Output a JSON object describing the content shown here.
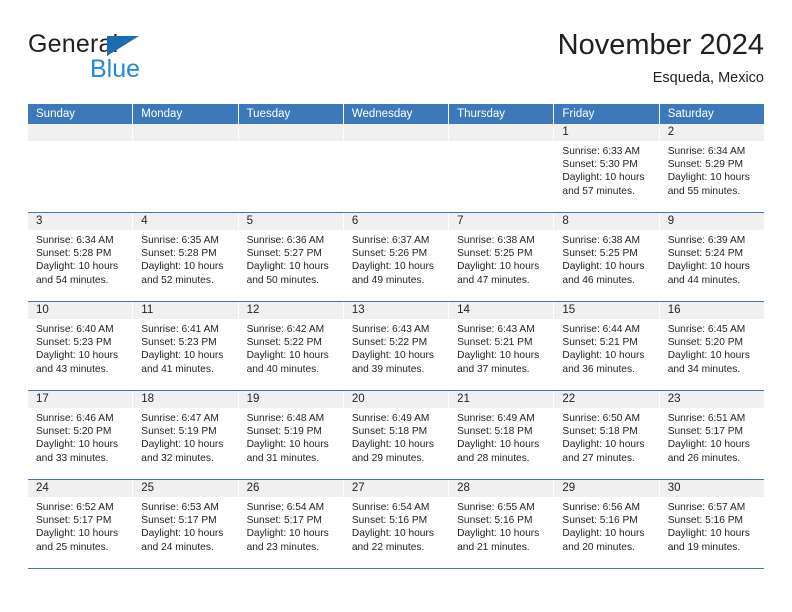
{
  "brand": {
    "name_part1": "General",
    "name_part2": "Blue",
    "triangle_icon": "blue-triangle-icon",
    "accent_color": "#2389d6",
    "header_color": "#3d79ba"
  },
  "header": {
    "title": "November 2024",
    "location": "Esqueda, Mexico"
  },
  "weekdays": [
    "Sunday",
    "Monday",
    "Tuesday",
    "Wednesday",
    "Thursday",
    "Friday",
    "Saturday"
  ],
  "weeks": [
    [
      {
        "day": "",
        "empty": true
      },
      {
        "day": "",
        "empty": true
      },
      {
        "day": "",
        "empty": true
      },
      {
        "day": "",
        "empty": true
      },
      {
        "day": "",
        "empty": true
      },
      {
        "day": "1",
        "sunrise": "Sunrise: 6:33 AM",
        "sunset": "Sunset: 5:30 PM",
        "daylight": "Daylight: 10 hours and 57 minutes."
      },
      {
        "day": "2",
        "sunrise": "Sunrise: 6:34 AM",
        "sunset": "Sunset: 5:29 PM",
        "daylight": "Daylight: 10 hours and 55 minutes."
      }
    ],
    [
      {
        "day": "3",
        "sunrise": "Sunrise: 6:34 AM",
        "sunset": "Sunset: 5:28 PM",
        "daylight": "Daylight: 10 hours and 54 minutes."
      },
      {
        "day": "4",
        "sunrise": "Sunrise: 6:35 AM",
        "sunset": "Sunset: 5:28 PM",
        "daylight": "Daylight: 10 hours and 52 minutes."
      },
      {
        "day": "5",
        "sunrise": "Sunrise: 6:36 AM",
        "sunset": "Sunset: 5:27 PM",
        "daylight": "Daylight: 10 hours and 50 minutes."
      },
      {
        "day": "6",
        "sunrise": "Sunrise: 6:37 AM",
        "sunset": "Sunset: 5:26 PM",
        "daylight": "Daylight: 10 hours and 49 minutes."
      },
      {
        "day": "7",
        "sunrise": "Sunrise: 6:38 AM",
        "sunset": "Sunset: 5:25 PM",
        "daylight": "Daylight: 10 hours and 47 minutes."
      },
      {
        "day": "8",
        "sunrise": "Sunrise: 6:38 AM",
        "sunset": "Sunset: 5:25 PM",
        "daylight": "Daylight: 10 hours and 46 minutes."
      },
      {
        "day": "9",
        "sunrise": "Sunrise: 6:39 AM",
        "sunset": "Sunset: 5:24 PM",
        "daylight": "Daylight: 10 hours and 44 minutes."
      }
    ],
    [
      {
        "day": "10",
        "sunrise": "Sunrise: 6:40 AM",
        "sunset": "Sunset: 5:23 PM",
        "daylight": "Daylight: 10 hours and 43 minutes."
      },
      {
        "day": "11",
        "sunrise": "Sunrise: 6:41 AM",
        "sunset": "Sunset: 5:23 PM",
        "daylight": "Daylight: 10 hours and 41 minutes."
      },
      {
        "day": "12",
        "sunrise": "Sunrise: 6:42 AM",
        "sunset": "Sunset: 5:22 PM",
        "daylight": "Daylight: 10 hours and 40 minutes."
      },
      {
        "day": "13",
        "sunrise": "Sunrise: 6:43 AM",
        "sunset": "Sunset: 5:22 PM",
        "daylight": "Daylight: 10 hours and 39 minutes."
      },
      {
        "day": "14",
        "sunrise": "Sunrise: 6:43 AM",
        "sunset": "Sunset: 5:21 PM",
        "daylight": "Daylight: 10 hours and 37 minutes."
      },
      {
        "day": "15",
        "sunrise": "Sunrise: 6:44 AM",
        "sunset": "Sunset: 5:21 PM",
        "daylight": "Daylight: 10 hours and 36 minutes."
      },
      {
        "day": "16",
        "sunrise": "Sunrise: 6:45 AM",
        "sunset": "Sunset: 5:20 PM",
        "daylight": "Daylight: 10 hours and 34 minutes."
      }
    ],
    [
      {
        "day": "17",
        "sunrise": "Sunrise: 6:46 AM",
        "sunset": "Sunset: 5:20 PM",
        "daylight": "Daylight: 10 hours and 33 minutes."
      },
      {
        "day": "18",
        "sunrise": "Sunrise: 6:47 AM",
        "sunset": "Sunset: 5:19 PM",
        "daylight": "Daylight: 10 hours and 32 minutes."
      },
      {
        "day": "19",
        "sunrise": "Sunrise: 6:48 AM",
        "sunset": "Sunset: 5:19 PM",
        "daylight": "Daylight: 10 hours and 31 minutes."
      },
      {
        "day": "20",
        "sunrise": "Sunrise: 6:49 AM",
        "sunset": "Sunset: 5:18 PM",
        "daylight": "Daylight: 10 hours and 29 minutes."
      },
      {
        "day": "21",
        "sunrise": "Sunrise: 6:49 AM",
        "sunset": "Sunset: 5:18 PM",
        "daylight": "Daylight: 10 hours and 28 minutes."
      },
      {
        "day": "22",
        "sunrise": "Sunrise: 6:50 AM",
        "sunset": "Sunset: 5:18 PM",
        "daylight": "Daylight: 10 hours and 27 minutes."
      },
      {
        "day": "23",
        "sunrise": "Sunrise: 6:51 AM",
        "sunset": "Sunset: 5:17 PM",
        "daylight": "Daylight: 10 hours and 26 minutes."
      }
    ],
    [
      {
        "day": "24",
        "sunrise": "Sunrise: 6:52 AM",
        "sunset": "Sunset: 5:17 PM",
        "daylight": "Daylight: 10 hours and 25 minutes."
      },
      {
        "day": "25",
        "sunrise": "Sunrise: 6:53 AM",
        "sunset": "Sunset: 5:17 PM",
        "daylight": "Daylight: 10 hours and 24 minutes."
      },
      {
        "day": "26",
        "sunrise": "Sunrise: 6:54 AM",
        "sunset": "Sunset: 5:17 PM",
        "daylight": "Daylight: 10 hours and 23 minutes."
      },
      {
        "day": "27",
        "sunrise": "Sunrise: 6:54 AM",
        "sunset": "Sunset: 5:16 PM",
        "daylight": "Daylight: 10 hours and 22 minutes."
      },
      {
        "day": "28",
        "sunrise": "Sunrise: 6:55 AM",
        "sunset": "Sunset: 5:16 PM",
        "daylight": "Daylight: 10 hours and 21 minutes."
      },
      {
        "day": "29",
        "sunrise": "Sunrise: 6:56 AM",
        "sunset": "Sunset: 5:16 PM",
        "daylight": "Daylight: 10 hours and 20 minutes."
      },
      {
        "day": "30",
        "sunrise": "Sunrise: 6:57 AM",
        "sunset": "Sunset: 5:16 PM",
        "daylight": "Daylight: 10 hours and 19 minutes."
      }
    ]
  ]
}
